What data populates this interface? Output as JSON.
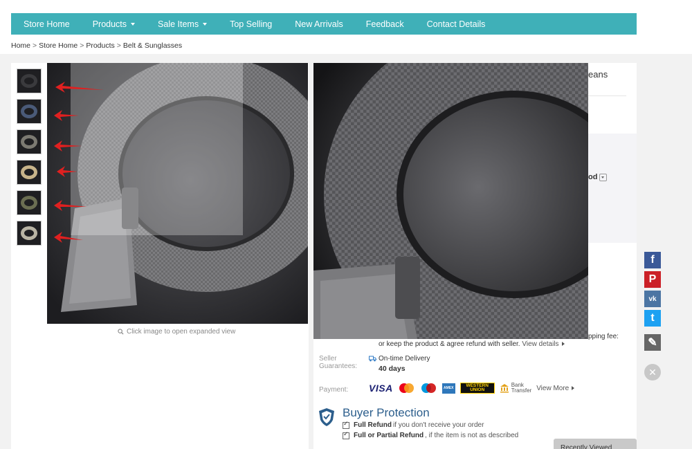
{
  "nav": {
    "items": [
      {
        "label": "Store Home",
        "has_dropdown": false
      },
      {
        "label": "Products",
        "has_dropdown": true
      },
      {
        "label": "Sale Items",
        "has_dropdown": true
      },
      {
        "label": "Top Selling",
        "has_dropdown": false
      },
      {
        "label": "New Arrivals",
        "has_dropdown": false
      },
      {
        "label": "Feedback",
        "has_dropdown": false
      },
      {
        "label": "Contact Details",
        "has_dropdown": false
      }
    ],
    "bg_color": "#3fb0b8"
  },
  "breadcrumb": [
    "Home",
    "Store Home",
    "Products",
    "Belt & Sunglasses"
  ],
  "gallery": {
    "hint": "Click image to open expanded view",
    "thumb_ring_colors": [
      "#3a3a3d",
      "#4a5a78",
      "#7c7a72",
      "#c8b48a",
      "#6b6e52",
      "#b9b4a4"
    ]
  },
  "product": {
    "title_fragment": "eans",
    "variant_fragment": "od"
  },
  "shipping": {
    "fee_fragment": "pping fee:",
    "refund_text": "or keep the product & agree refund with seller.",
    "view_details": "View details"
  },
  "guarantee": {
    "label": "Seller Guarantees:",
    "delivery": "On-time Delivery",
    "days": "40 days"
  },
  "payment": {
    "label": "Payment:",
    "visa": "VISA",
    "wu": "WESTERN UNION",
    "bank": "Bank Transfer",
    "bank_line1": "Bank",
    "bank_line2": "Transfer",
    "view_more": "View More"
  },
  "buyer_protection": {
    "title": "Buyer Protection",
    "full_refund_bold": "Full Refund",
    "full_refund_text": "if you don't receive your order",
    "partial_refund_bold": "Full or Partial Refund",
    "partial_refund_text": ", if the item is not as described"
  },
  "social": {
    "items": [
      {
        "icon": "facebook-icon",
        "glyph": "f",
        "color": "#3b5998"
      },
      {
        "icon": "pinterest-icon",
        "glyph": "P",
        "color": "#cb2027"
      },
      {
        "icon": "vk-icon",
        "glyph": "vk",
        "color": "#4c75a3"
      },
      {
        "icon": "twitter-icon",
        "glyph": "t",
        "color": "#1da1f2"
      },
      {
        "icon": "pencil-icon",
        "glyph": "✎",
        "color": "#666666"
      }
    ],
    "close_glyph": "✕"
  },
  "recently_viewed": "Recently Viewed"
}
